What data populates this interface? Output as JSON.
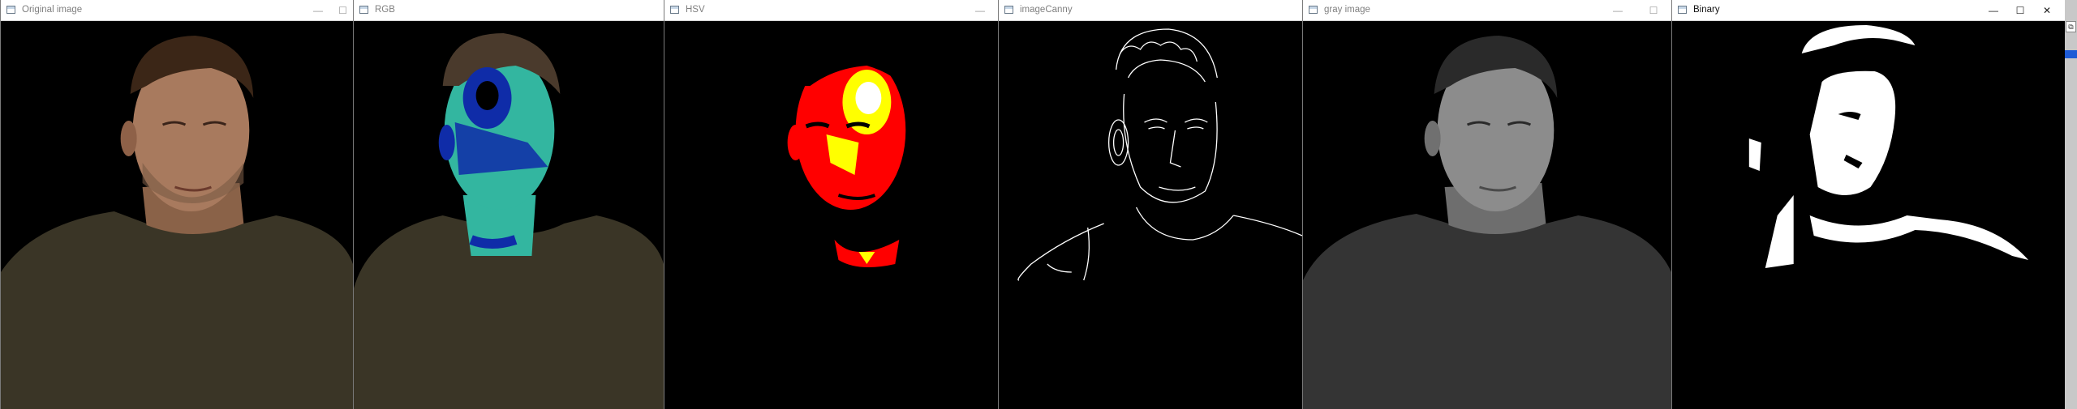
{
  "windows": [
    {
      "title": "Original image",
      "icon": "window-app-icon",
      "active": false
    },
    {
      "title": "RGB",
      "icon": "window-app-icon",
      "active": false
    },
    {
      "title": "HSV",
      "icon": "window-app-icon",
      "active": false
    },
    {
      "title": "imageCanny",
      "icon": "window-app-icon",
      "active": false
    },
    {
      "title": "gray image",
      "icon": "window-app-icon",
      "active": false
    },
    {
      "title": "Binary",
      "icon": "window-app-icon",
      "active": true
    }
  ],
  "controls": {
    "minimize": "—",
    "maximize": "☐",
    "close": "✕"
  },
  "colors": {
    "sweater": "#3a3526",
    "skin": "#a87a5e",
    "rgb_teal": "#33b6a0",
    "rgb_blue": "#0f2ca8",
    "hsv_red": "#ff0000",
    "hsv_yellow": "#ffff00",
    "binary_white": "#ffffff",
    "background": "#000000"
  }
}
